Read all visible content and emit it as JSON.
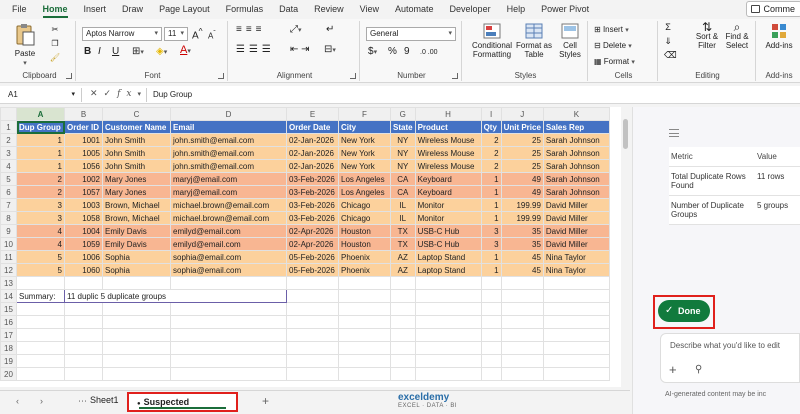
{
  "menu": {
    "tabs": [
      "File",
      "Home",
      "Insert",
      "Draw",
      "Page Layout",
      "Formulas",
      "Data",
      "Review",
      "View",
      "Automate",
      "Developer",
      "Help",
      "Power Pivot"
    ],
    "active": "Home",
    "comments_label": "Comme"
  },
  "ribbon": {
    "clipboard": {
      "paste": "Paste",
      "label": "Clipboard"
    },
    "font": {
      "name": "Aptos Narrow",
      "size": "11",
      "label": "Font",
      "bold": "B",
      "italic": "I",
      "underline": "U",
      "grow": "A",
      "shrink": "A"
    },
    "alignment": {
      "label": "Alignment"
    },
    "number": {
      "format": "General",
      "label": "Number",
      "currency": "$",
      "percent": "%",
      "comma": "9"
    },
    "styles": {
      "conditional": "Conditional Formatting",
      "table": "Format as Table",
      "cell": "Cell Styles",
      "label": "Styles"
    },
    "cells": {
      "insert": "Insert",
      "delete": "Delete",
      "format": "Format",
      "label": "Cells"
    },
    "editing": {
      "sort": "Sort & Filter",
      "find": "Find & Select",
      "label": "Editing"
    },
    "addins": {
      "button": "Add-ins",
      "label": "Add-ins"
    }
  },
  "formula_bar": {
    "cell_ref": "A1",
    "cancel": "✕",
    "enter": "✓",
    "fx": "fx",
    "content": "Dup Group"
  },
  "sheet": {
    "columns": [
      "A",
      "B",
      "C",
      "D",
      "E",
      "F",
      "G",
      "H",
      "I",
      "J",
      "K"
    ],
    "header": [
      "Dup Group",
      "Order ID",
      "Customer Name",
      "Email",
      "Order Date",
      "City",
      "State",
      "Product",
      "Qty",
      "Unit Price",
      "Sales Rep"
    ],
    "rows": [
      {
        "g": "1",
        "id": "1001",
        "name": "John Smith",
        "email": "john.smith@email.com",
        "date": "02-Jan-2026",
        "city": "New York",
        "state": "NY",
        "product": "Wireless Mouse",
        "qty": "2",
        "price": "25",
        "rep": "Sarah Johnson"
      },
      {
        "g": "1",
        "id": "1005",
        "name": "John Smith",
        "email": "john.smith@email.com",
        "date": "02-Jan-2026",
        "city": "New York",
        "state": "NY",
        "product": "Wireless Mouse",
        "qty": "2",
        "price": "25",
        "rep": "Sarah Johnson"
      },
      {
        "g": "1",
        "id": "1056",
        "name": "John Smith",
        "email": "john.smith@email.com",
        "date": "02-Jan-2026",
        "city": "New York",
        "state": "NY",
        "product": "Wireless Mouse",
        "qty": "2",
        "price": "25",
        "rep": "Sarah Johnson"
      },
      {
        "g": "2",
        "id": "1002",
        "name": "Mary Jones",
        "email": "maryj@email.com",
        "date": "03-Feb-2026",
        "city": "Los Angeles",
        "state": "CA",
        "product": "Keyboard",
        "qty": "1",
        "price": "49",
        "rep": "Sarah Johnson"
      },
      {
        "g": "2",
        "id": "1057",
        "name": "Mary Jones",
        "email": "maryj@email.com",
        "date": "03-Feb-2026",
        "city": "Los Angeles",
        "state": "CA",
        "product": "Keyboard",
        "qty": "1",
        "price": "49",
        "rep": "Sarah Johnson"
      },
      {
        "g": "3",
        "id": "1003",
        "name": "Brown, Michael",
        "email": "michael.brown@email.com",
        "date": "03-Feb-2026",
        "city": "Chicago",
        "state": "IL",
        "product": "Monitor",
        "qty": "1",
        "price": "199.99",
        "rep": "David Miller"
      },
      {
        "g": "3",
        "id": "1058",
        "name": "Brown, Michael",
        "email": "michael.brown@email.com",
        "date": "03-Feb-2026",
        "city": "Chicago",
        "state": "IL",
        "product": "Monitor",
        "qty": "1",
        "price": "199.99",
        "rep": "David Miller"
      },
      {
        "g": "4",
        "id": "1004",
        "name": "Emily Davis",
        "email": "emilyd@email.com",
        "date": "02-Apr-2026",
        "city": "Houston",
        "state": "TX",
        "product": "USB-C Hub",
        "qty": "3",
        "price": "35",
        "rep": "David Miller"
      },
      {
        "g": "4",
        "id": "1059",
        "name": "Emily Davis",
        "email": "emilyd@email.com",
        "date": "02-Apr-2026",
        "city": "Houston",
        "state": "TX",
        "product": "USB-C Hub",
        "qty": "3",
        "price": "35",
        "rep": "David Miller"
      },
      {
        "g": "5",
        "id": "1006",
        "name": "Sophia",
        "email": "sophia@email.com",
        "date": "05-Feb-2026",
        "city": "Phoenix",
        "state": "AZ",
        "product": "Laptop Stand",
        "qty": "1",
        "price": "45",
        "rep": "Nina Taylor"
      },
      {
        "g": "5",
        "id": "1060",
        "name": "Sophia",
        "email": "sophia@email.com",
        "date": "05-Feb-2026",
        "city": "Phoenix",
        "state": "AZ",
        "product": "Laptop Stand",
        "qty": "1",
        "price": "45",
        "rep": "Nina Taylor"
      }
    ],
    "summary_label": "Summary:",
    "summary_text": "11 duplic 5 duplicate groups",
    "row_numbers": [
      "1",
      "2",
      "3",
      "4",
      "5",
      "6",
      "7",
      "8",
      "9",
      "10",
      "11",
      "12",
      "13",
      "14",
      "15",
      "16",
      "17",
      "18",
      "19",
      "20"
    ]
  },
  "tabs": {
    "sheet1": "Sheet1",
    "active": "Suspected Duplicates",
    "add": "+"
  },
  "watermark": {
    "name": "exceldemy",
    "tag": "EXCEL · DATA · BI"
  },
  "panel": {
    "head_key": "Metric",
    "head_val": "Value",
    "rows": [
      {
        "k": "Total Duplicate Rows Found",
        "v": "11 rows"
      },
      {
        "k": "Number of Duplicate Groups",
        "v": "5 groups"
      }
    ],
    "done": "Done",
    "prompt_placeholder": "Describe what you'd like to edit",
    "ai_note": "AI-generated content may be inc"
  },
  "colors": {
    "accent": "#1b6d3a",
    "header_blue": "#4472c4",
    "group_orange_light": "#fcd19c",
    "group_orange_dark": "#f8b692",
    "highlight_red": "#e0201c"
  }
}
